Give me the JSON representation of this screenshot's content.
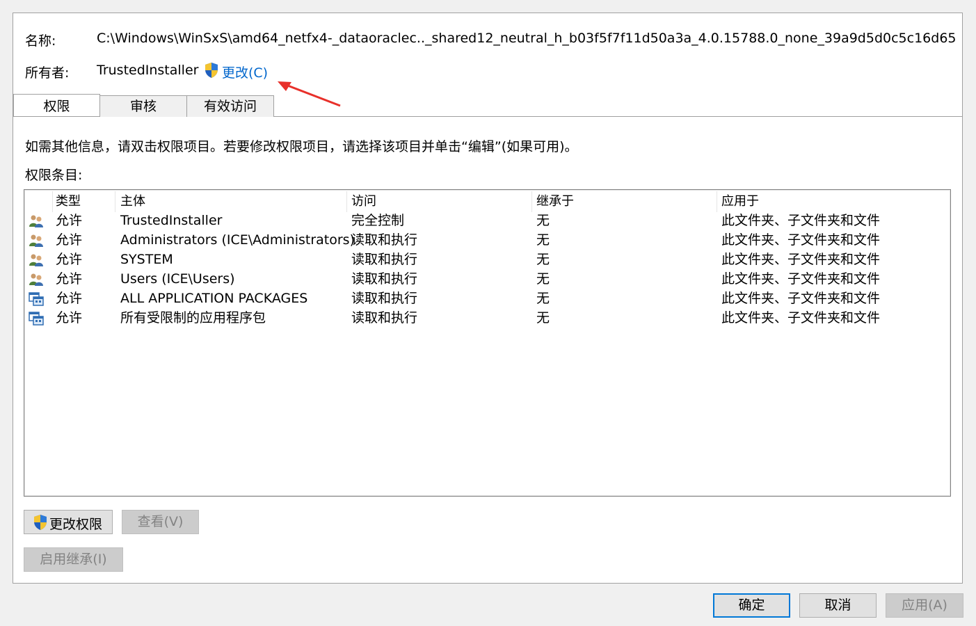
{
  "header": {
    "name_label": "名称:",
    "name_value": "C:\\Windows\\WinSxS\\amd64_netfx4-_dataoraclec.._shared12_neutral_h_b03f5f7f11d50a3a_4.0.15788.0_none_39a9d5d0c5c16d65",
    "owner_label": "所有者:",
    "owner_value": "TrustedInstaller",
    "change_owner_link": "更改(C)"
  },
  "tabs": [
    {
      "label": "权限",
      "active": true
    },
    {
      "label": "审核",
      "active": false
    },
    {
      "label": "有效访问",
      "active": false
    }
  ],
  "permissions": {
    "info_text": "如需其他信息，请双击权限项目。若要修改权限项目，请选择该项目并单击“编辑”(如果可用)。",
    "entries_label": "权限条目:",
    "columns": [
      "类型",
      "主体",
      "访问",
      "继承于",
      "应用于"
    ],
    "rows": [
      {
        "icon": "users-group-icon",
        "type": "允许",
        "principal": "TrustedInstaller",
        "access": "完全控制",
        "inherited": "无",
        "applies": "此文件夹、子文件夹和文件"
      },
      {
        "icon": "users-group-icon",
        "type": "允许",
        "principal": "Administrators (ICE\\Administrators)",
        "access": "读取和执行",
        "inherited": "无",
        "applies": "此文件夹、子文件夹和文件"
      },
      {
        "icon": "users-group-icon",
        "type": "允许",
        "principal": "SYSTEM",
        "access": "读取和执行",
        "inherited": "无",
        "applies": "此文件夹、子文件夹和文件"
      },
      {
        "icon": "users-group-icon",
        "type": "允许",
        "principal": "Users (ICE\\Users)",
        "access": "读取和执行",
        "inherited": "无",
        "applies": "此文件夹、子文件夹和文件"
      },
      {
        "icon": "app-package-icon",
        "type": "允许",
        "principal": "ALL APPLICATION PACKAGES",
        "access": "读取和执行",
        "inherited": "无",
        "applies": "此文件夹、子文件夹和文件"
      },
      {
        "icon": "app-package-icon",
        "type": "允许",
        "principal": "所有受限制的应用程序包",
        "access": "读取和执行",
        "inherited": "无",
        "applies": "此文件夹、子文件夹和文件"
      }
    ],
    "change_permissions_button": "更改权限",
    "view_button": "查看(V)",
    "enable_inheritance_button": "启用继承(I)"
  },
  "footer": {
    "ok_button": "确定",
    "cancel_button": "取消",
    "apply_button": "应用(A)"
  },
  "colors": {
    "link": "#0066cc",
    "annotation_arrow": "#e8302a",
    "default_button_border": "#0078d7"
  }
}
